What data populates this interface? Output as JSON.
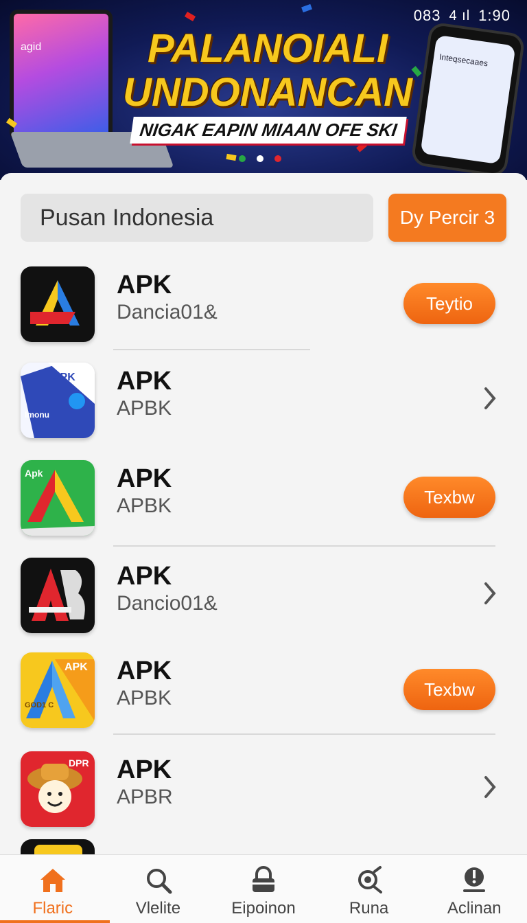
{
  "status_bar": {
    "left": "083",
    "time": "1:90",
    "signal": "4 ıl"
  },
  "banner": {
    "headline_line1": "PALANOIALI",
    "headline_line2": "UNDONANCAN",
    "tagline": "NIGAK EAPIN MIAAN OFE SKI",
    "laptop_screen_label": "agid",
    "phone_screen_label": "Inteqsecaaes"
  },
  "search": {
    "value": "Pusan Indonesia"
  },
  "filter_button": {
    "label": "Dy Percir 3"
  },
  "apps": [
    {
      "title": "APK",
      "subtitle": "Dancia01&",
      "action": "Teytio",
      "icon": "app-a-dark-icon"
    },
    {
      "title": "APK",
      "subtitle": "APBK",
      "action": "",
      "icon": "app-apk-blue-icon",
      "icon_text": "APK",
      "icon_text2": "Imonu"
    },
    {
      "title": "APK",
      "subtitle": "APBK",
      "action": "Texbw",
      "icon": "app-green-icon",
      "icon_text": "Apk"
    },
    {
      "title": "APK",
      "subtitle": "Dancio01&",
      "action": "",
      "icon": "app-red-dark-icon"
    },
    {
      "title": "APK",
      "subtitle": "APBK",
      "action": "Texbw",
      "icon": "app-yellow-icon",
      "icon_text": "APK",
      "icon_text2": "GOD1 C"
    },
    {
      "title": "APK",
      "subtitle": "APBR",
      "action": "",
      "icon": "app-mascot-icon",
      "icon_text": "DPR"
    }
  ],
  "bottom_nav": [
    {
      "label": "Flaric",
      "icon": "home-icon",
      "active": true
    },
    {
      "label": "Vlelite",
      "icon": "search-icon",
      "active": false
    },
    {
      "label": "Eipoinon",
      "icon": "lock-icon",
      "active": false
    },
    {
      "label": "Runa",
      "icon": "gear-search-icon",
      "active": false
    },
    {
      "label": "Aclinan",
      "icon": "alert-icon",
      "active": false
    }
  ],
  "colors": {
    "accent": "#f47a20",
    "banner_bg": "#101a55",
    "headline": "#f7c81e"
  }
}
